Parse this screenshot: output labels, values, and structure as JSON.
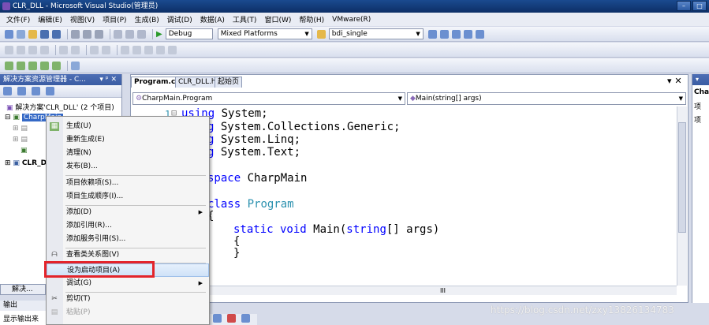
{
  "window": {
    "title": "CLR_DLL - Microsoft Visual Studio(管理员)",
    "min_label": "–",
    "max_label": "□"
  },
  "menu": [
    "文件(F)",
    "编辑(E)",
    "视图(V)",
    "项目(P)",
    "生成(B)",
    "调试(D)",
    "数据(A)",
    "工具(T)",
    "窗口(W)",
    "帮助(H)",
    "VMware(R)"
  ],
  "toolbar": {
    "config": "Debug",
    "platform": "Mixed Platforms",
    "search": "bdi_single"
  },
  "solution_explorer": {
    "title": "解决方案资源管理器 - C...",
    "pin": "▾ ᵖ ✕",
    "solution": "解决方案'CLR_DLL' (2 个项目)",
    "project1": "CharpMain",
    "project2": "CLR_DLL",
    "bottom_tab": "解决..."
  },
  "editor": {
    "tabs": [
      "Program.cs",
      "CLR_DLL.h",
      "起始页"
    ],
    "class_combo": "CharpMain.Program",
    "member_combo": "Main(string[] args)",
    "close": "▾ ✕",
    "lines": [
      {
        "kw": "using",
        "rest": " System;"
      },
      {
        "kw": "g",
        "rest": " System.Collections.Generic;"
      },
      {
        "kw": "g",
        "rest": " System.Linq;"
      },
      {
        "kw": "g",
        "rest": " System.Text;"
      },
      {
        "kw": "space",
        "rest": " CharpMain"
      },
      {
        "kw": "class",
        "rest": " ",
        "type": "Program"
      },
      {
        "kw": "",
        "rest": "{"
      },
      {
        "kw": "static void",
        "rest": " Main(",
        "type2": "string",
        "rest2": "[] args)"
      },
      {
        "kw": "",
        "rest": "{"
      },
      {
        "kw": "",
        "rest": "}"
      }
    ],
    "line_number": "1"
  },
  "context_menu": [
    {
      "label": "生成(U)",
      "icon": "build-icon"
    },
    {
      "label": "重新生成(E)"
    },
    {
      "label": "清理(N)"
    },
    {
      "label": "发布(B)..."
    },
    {
      "sep": true
    },
    {
      "label": "项目依赖项(S)..."
    },
    {
      "label": "项目生成顺序(I)..."
    },
    {
      "sep": true
    },
    {
      "label": "添加(D)",
      "sub": true
    },
    {
      "label": "添加引用(R)..."
    },
    {
      "label": "添加服务引用(S)..."
    },
    {
      "sep": true
    },
    {
      "label": "查看类关系图(V)",
      "icon": "class-diagram-icon"
    },
    {
      "sep": true
    },
    {
      "label": "设为启动项目(A)",
      "highlight": true
    },
    {
      "label": "调试(G)",
      "sub": true
    },
    {
      "sep": true
    },
    {
      "label": "剪切(T)",
      "icon": "cut-icon"
    },
    {
      "label": "粘贴(P)",
      "icon": "paste-icon"
    }
  ],
  "output": {
    "title": "输出",
    "label": "显示输出来"
  },
  "watermark": "https://blog.csdn.net/zxy13826134783",
  "right_panel": {
    "title": "Cha",
    "items": [
      "项",
      "项"
    ]
  },
  "scroll_label": "III"
}
